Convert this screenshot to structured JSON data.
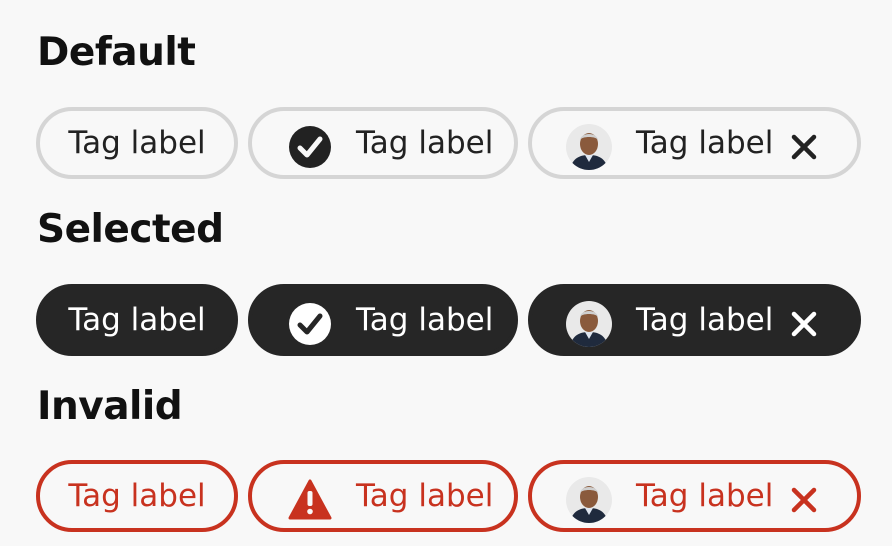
{
  "sections": [
    {
      "heading": "Default",
      "tags": [
        {
          "label": "Tag label",
          "leading": "none"
        },
        {
          "label": "Tag label",
          "leading": "checkmark-circle-icon"
        },
        {
          "label": "Tag label",
          "leading": "avatar",
          "removable": true
        }
      ]
    },
    {
      "heading": "Selected",
      "tags": [
        {
          "label": "Tag label",
          "leading": "none"
        },
        {
          "label": "Tag label",
          "leading": "checkmark-circle-icon"
        },
        {
          "label": "Tag label",
          "leading": "avatar",
          "removable": true
        }
      ]
    },
    {
      "heading": "Invalid",
      "tags": [
        {
          "label": "Tag label",
          "leading": "none"
        },
        {
          "label": "Tag label",
          "leading": "alert-triangle-icon"
        },
        {
          "label": "Tag label",
          "leading": "avatar",
          "removable": true
        }
      ]
    }
  ],
  "colors": {
    "background": "#f8f8f8",
    "default_border": "#d5d5d5",
    "selected_fill": "#262626",
    "invalid": "#c8321f",
    "text": "#222222"
  }
}
